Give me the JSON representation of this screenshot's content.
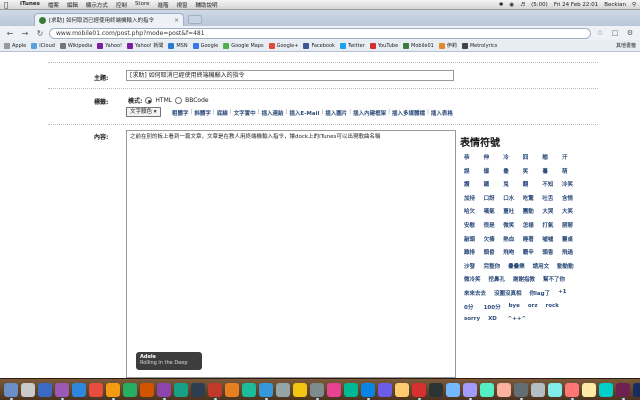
{
  "menubar": {
    "apple": "",
    "items": [
      "iTunes",
      "檔案",
      "編輯",
      "顯示方式",
      "控制",
      "Store",
      "進階",
      "視窗",
      "輔助說明"
    ],
    "status": {
      "battery": "(5:00)",
      "datetime": "Fri 24 Feb  22:01",
      "user": "Beckian"
    }
  },
  "browser": {
    "tab_title": "[求助] 如何取消已經使用終端機輸入的指令",
    "url": "www.mobile01.com/post.php?mode=post&f=481",
    "bookmarks": [
      {
        "label": "Apple",
        "color": "#999999"
      },
      {
        "label": "iCloud",
        "color": "#5aa0e0"
      },
      {
        "label": "Wikipedia",
        "color": "#777777"
      },
      {
        "label": "Yahoo!",
        "color": "#7b1fa2"
      },
      {
        "label": "Yahoo! 新聞",
        "color": "#7b1fa2"
      },
      {
        "label": "MSN",
        "color": "#2a7ad8"
      },
      {
        "label": "Google",
        "color": "#3b78e7"
      },
      {
        "label": "Google Maps",
        "color": "#4caf50"
      },
      {
        "label": "Google+",
        "color": "#dd4b39"
      },
      {
        "label": "Facebook",
        "color": "#3b5998"
      },
      {
        "label": "Twitter",
        "color": "#1da1f2"
      },
      {
        "label": "YouTube",
        "color": "#d32f2f"
      },
      {
        "label": "Mobile01",
        "color": "#3a7c3a"
      },
      {
        "label": "伊莉",
        "color": "#e08a2a"
      },
      {
        "label": "Metrolyrics",
        "color": "#444444"
      }
    ],
    "other_bookmarks": "其他書籤"
  },
  "form": {
    "subject_label": "主題:",
    "subject_value": "[求助] 如何取消已經使用終端機輸入的指令",
    "tag_label": "標籤:",
    "mode_label": "模式:",
    "mode_html": "HTML",
    "mode_bbcode": "BBCode",
    "color_select": "文字顏色",
    "format_links": [
      "粗體字",
      "斜體字",
      "底線",
      "文字置中",
      "插入連結",
      "插入E-Mail",
      "插入圖片",
      "插入內建框架",
      "插入多媒體檔",
      "插入表格"
    ],
    "content_label": "內容:",
    "content_value": "之前在別的板上看到一篇文章，文章是在教人用終端機輸入指令，讓dock上的iTunes可以出現歌曲名稱"
  },
  "emoticons": {
    "title": "表情符號",
    "items": [
      "恭",
      "伸",
      "冷",
      "囧",
      "翹",
      "汗",
      "誤",
      "爆",
      "叠",
      "笑",
      "驀",
      "萌",
      "讚",
      "鐵",
      "兎",
      "翻",
      "不知",
      "冷笑",
      "加持",
      "口訝",
      "口水",
      "吃驚",
      "吐舌",
      "含情",
      "哈欠",
      "嘆氣",
      "噩吐",
      "團動",
      "大哭",
      "大笑",
      "安慰",
      "很是",
      "微笑",
      "怎樣",
      "打氣",
      "掰掰",
      "敲頭",
      "欠揍",
      "熱血",
      "睡著",
      "噓噓",
      "靈桌",
      "難排",
      "頭昏",
      "飛吻",
      "霸辛",
      "頭香",
      "飛過",
      "沙發",
      "完整你",
      "疊疊樂",
      "請用文",
      "動動動",
      "微冷笑",
      "挖鼻孔",
      "謝謝指教",
      "幫不了你",
      "來來去去",
      "沒圖沒真相",
      "你lag了",
      "+1",
      "0分",
      "100分",
      "bye",
      "orz",
      "rock",
      "sorry",
      "XD",
      "^++^"
    ]
  },
  "tooltip": {
    "artist": "Adele",
    "song": "Rolling in the Deep"
  },
  "dock": {
    "icons": [
      "#6a8fc7",
      "#c9c9c9",
      "#3a6bc4",
      "#9b59b6",
      "#2e86de",
      "#e74c3c",
      "#f39c12",
      "#27ae60",
      "#d35400",
      "#8e44ad",
      "#16a085",
      "#2c3e50",
      "#c0392b",
      "#e67e22",
      "#1abc9c",
      "#3498db",
      "#95a5a6",
      "#f1c40f",
      "#7f8c8d",
      "#e84393",
      "#00b894",
      "#0984e3",
      "#6c5ce7",
      "#fdcb6e",
      "#d63031",
      "#2d3436",
      "#74b9ff",
      "#a29bfe",
      "#55efc4",
      "#fab1a0",
      "#636e72",
      "#b2bec3",
      "#81ecec",
      "#ff7675",
      "#ffeaa7",
      "#00cec9",
      "#6d214f",
      "#182c61",
      "#3b3b98",
      "#fd7272"
    ]
  }
}
